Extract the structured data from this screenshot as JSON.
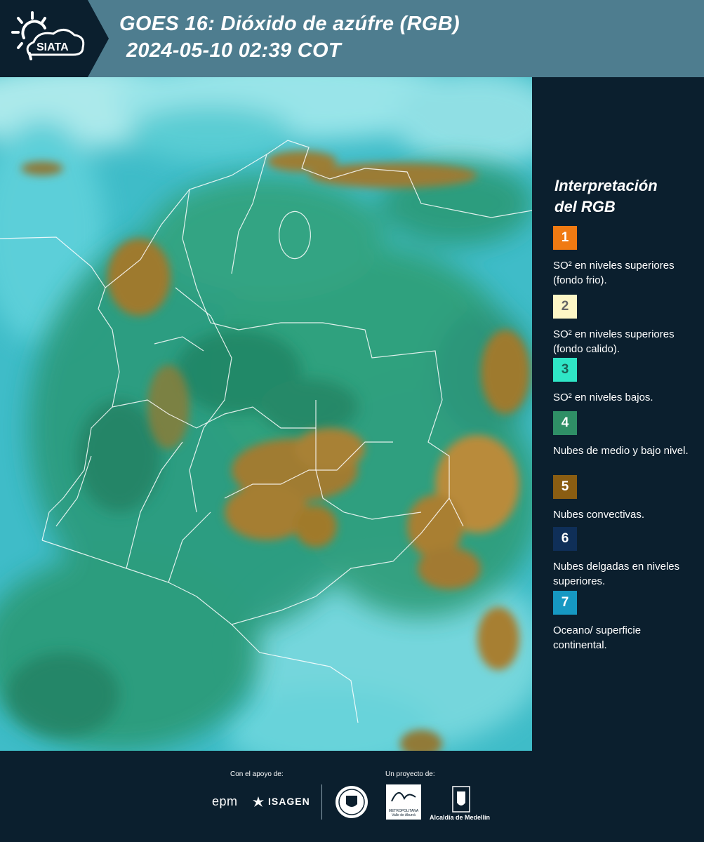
{
  "header": {
    "title_line1": "GOES 16: Dióxido de azúfre (RGB)",
    "title_line2": "2024-05-10 02:39 COT",
    "logo_text": "SIATA"
  },
  "legend": {
    "title_line1": "Interpretación",
    "title_line2": "del RGB",
    "items": [
      {
        "num": "1",
        "label": "SO² en niveles superiores (fondo frio).",
        "color": "#f07a12",
        "text_color": "#ffffff"
      },
      {
        "num": "2",
        "label": "SO² en niveles superiores (fondo calido).",
        "color": "#fdf6c6",
        "text_color": "#666666"
      },
      {
        "num": "3",
        "label": "SO² en niveles bajos.",
        "color": "#2fe5c6",
        "text_color": "#1b5f55"
      },
      {
        "num": "4",
        "label": "Nubes de medio y bajo nivel.",
        "color": "#2f8f66",
        "text_color": "#ffffff"
      },
      {
        "num": "5",
        "label": "Nubes convectivas.",
        "color": "#8a5d12",
        "text_color": "#ffffff"
      },
      {
        "num": "6",
        "label": "Nubes delgadas en niveles superiores.",
        "color": "#0f2f58",
        "text_color": "#ffffff"
      },
      {
        "num": "7",
        "label": "Oceano/ superficie continental.",
        "color": "#1698c2",
        "text_color": "#ffffff"
      }
    ]
  },
  "footer": {
    "support_label": "Con el apoyo de:",
    "project_label": "Un proyecto de:",
    "sponsor1": "epm",
    "sponsor2": "ISAGEN",
    "partner1_line1": "METROPOLITANA",
    "partner1_line2": "Valle de Aburrá",
    "partner2": "Alcaldía de Medellín"
  }
}
